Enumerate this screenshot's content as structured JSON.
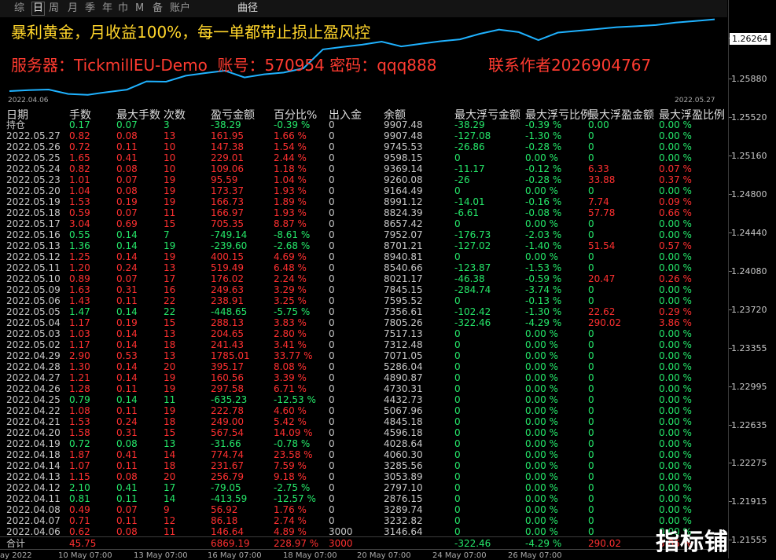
{
  "colors": {
    "profit": "#ff3030",
    "loss": "#25e86a",
    "neutral": "#c8c8c8",
    "equity_line": "#1fb2ff",
    "accent_yellow": "#ffd52b"
  },
  "periods": [
    "综",
    "日",
    "周",
    "月",
    "季",
    "年",
    "巾",
    "M",
    "备",
    "账户"
  ],
  "periods_active": 1,
  "equity_tab": "曲径",
  "banner": {
    "line1": "暴利黄金，月收益100%，每一单都带止损止盈风控",
    "server": "服务器：TickmillEU-Demo  账号：570954 密码：qqq888",
    "contact": "联系作者2026904767"
  },
  "chart_dates": {
    "start": "2022.04.06",
    "end": "2022.05.27"
  },
  "equity_curve": [
    3146.64,
    3232.82,
    3289.74,
    2876.15,
    2797.1,
    3053.89,
    3285.56,
    4060.3,
    4028.64,
    4596.18,
    4845.18,
    5067.96,
    4432.73,
    4730.31,
    4890.87,
    5286.04,
    7071.05,
    7312.48,
    7517.13,
    7805.26,
    7356.61,
    7595.52,
    7845.15,
    8021.17,
    8540.66,
    8940.81,
    8701.21,
    7952.07,
    8657.42,
    8824.39,
    8991.12,
    9164.49,
    9260.08,
    9369.14,
    9598.15,
    9745.53,
    9907.48
  ],
  "price_axis": [
    "1.26264",
    "1.25880",
    "1.25520",
    "1.25160",
    "1.24800",
    "1.24440",
    "1.24080",
    "1.23720",
    "1.23355",
    "1.22995",
    "1.22635",
    "1.22275",
    "1.21915",
    "1.21555"
  ],
  "headers": [
    "日期",
    "手数",
    "最大手数",
    "次数",
    "盈亏金额",
    "百分比%",
    "出入金",
    "余额",
    "最大浮亏金额",
    "最大浮亏比例",
    "最大浮盈金额",
    "最大浮盈比例"
  ],
  "rows": [
    [
      "持仓",
      "0.17",
      "0.07",
      "3",
      "-38.29",
      "-0.39 %",
      "0",
      "9907.48",
      "-38.29",
      "-0.39 %",
      "0.00",
      "0.00 %"
    ],
    [
      "2022.05.27",
      "0.82",
      "0.08",
      "13",
      "161.95",
      "1.66 %",
      "0",
      "9907.48",
      "-127.08",
      "-1.30 %",
      "0",
      "0.00 %"
    ],
    [
      "2022.05.26",
      "0.72",
      "0.11",
      "10",
      "147.38",
      "1.54 %",
      "0",
      "9745.53",
      "-26.86",
      "-0.28 %",
      "0",
      "0.00 %"
    ],
    [
      "2022.05.25",
      "1.65",
      "0.41",
      "10",
      "229.01",
      "2.44 %",
      "0",
      "9598.15",
      "0",
      "0.00 %",
      "0",
      "0.00 %"
    ],
    [
      "2022.05.24",
      "0.82",
      "0.08",
      "10",
      "109.06",
      "1.18 %",
      "0",
      "9369.14",
      "-11.17",
      "-0.12 %",
      "6.33",
      "0.07 %"
    ],
    [
      "2022.05.23",
      "1.01",
      "0.07",
      "19",
      "95.59",
      "1.04 %",
      "0",
      "9260.08",
      "-26",
      "-0.28 %",
      "33.88",
      "0.37 %"
    ],
    [
      "2022.05.20",
      "1.04",
      "0.08",
      "19",
      "173.37",
      "1.93 %",
      "0",
      "9164.49",
      "0",
      "0.00 %",
      "0",
      "0.00 %"
    ],
    [
      "2022.05.19",
      "1.53",
      "0.19",
      "19",
      "166.73",
      "1.89 %",
      "0",
      "8991.12",
      "-14.01",
      "-0.16 %",
      "7.74",
      "0.09 %"
    ],
    [
      "2022.05.18",
      "0.59",
      "0.07",
      "11",
      "166.97",
      "1.93 %",
      "0",
      "8824.39",
      "-6.61",
      "-0.08 %",
      "57.78",
      "0.66 %"
    ],
    [
      "2022.05.17",
      "3.04",
      "0.69",
      "15",
      "705.35",
      "8.87 %",
      "0",
      "8657.42",
      "0",
      "0.00 %",
      "0",
      "0.00 %"
    ],
    [
      "2022.05.16",
      "0.55",
      "0.14",
      "7",
      "-749.14",
      "-8.61 %",
      "0",
      "7952.07",
      "-176.73",
      "-2.03 %",
      "0",
      "0.00 %"
    ],
    [
      "2022.05.13",
      "1.36",
      "0.14",
      "19",
      "-239.60",
      "-2.68 %",
      "0",
      "8701.21",
      "-127.02",
      "-1.40 %",
      "51.54",
      "0.57 %"
    ],
    [
      "2022.05.12",
      "1.25",
      "0.14",
      "19",
      "400.15",
      "4.69 %",
      "0",
      "8940.81",
      "0",
      "0.00 %",
      "0",
      "0.00 %"
    ],
    [
      "2022.05.11",
      "1.20",
      "0.24",
      "13",
      "519.49",
      "6.48 %",
      "0",
      "8540.66",
      "-123.87",
      "-1.53 %",
      "0",
      "0.00 %"
    ],
    [
      "2022.05.10",
      "0.89",
      "0.07",
      "17",
      "176.02",
      "2.24 %",
      "0",
      "8021.17",
      "-46.38",
      "-0.59 %",
      "20.47",
      "0.26 %"
    ],
    [
      "2022.05.09",
      "1.63",
      "0.31",
      "16",
      "249.63",
      "3.29 %",
      "0",
      "7845.15",
      "-284.74",
      "-3.74 %",
      "0",
      "0.00 %"
    ],
    [
      "2022.05.06",
      "1.43",
      "0.11",
      "22",
      "238.91",
      "3.25 %",
      "0",
      "7595.52",
      "0",
      "-0.13 %",
      "0",
      "0.00 %"
    ],
    [
      "2022.05.05",
      "1.47",
      "0.14",
      "22",
      "-448.65",
      "-5.75 %",
      "0",
      "7356.61",
      "-102.42",
      "-1.30 %",
      "22.62",
      "0.29 %"
    ],
    [
      "2022.05.04",
      "1.17",
      "0.19",
      "15",
      "288.13",
      "3.83 %",
      "0",
      "7805.26",
      "-322.46",
      "-4.29 %",
      "290.02",
      "3.86 %"
    ],
    [
      "2022.05.03",
      "1.03",
      "0.14",
      "13",
      "204.65",
      "2.80 %",
      "0",
      "7517.13",
      "0",
      "0.00 %",
      "0",
      "0.00 %"
    ],
    [
      "2022.05.02",
      "1.17",
      "0.14",
      "18",
      "241.43",
      "3.41 %",
      "0",
      "7312.48",
      "0",
      "0.00 %",
      "0",
      "0.00 %"
    ],
    [
      "2022.04.29",
      "2.90",
      "0.53",
      "13",
      "1785.01",
      "33.77 %",
      "0",
      "7071.05",
      "0",
      "0.00 %",
      "0",
      "0.00 %"
    ],
    [
      "2022.04.28",
      "1.30",
      "0.14",
      "20",
      "395.17",
      "8.08 %",
      "0",
      "5286.04",
      "0",
      "0.00 %",
      "0",
      "0.00 %"
    ],
    [
      "2022.04.27",
      "1.21",
      "0.14",
      "19",
      "160.56",
      "3.39 %",
      "0",
      "4890.87",
      "0",
      "0.00 %",
      "0",
      "0.00 %"
    ],
    [
      "2022.04.26",
      "1.28",
      "0.11",
      "19",
      "297.58",
      "6.71 %",
      "0",
      "4730.31",
      "0",
      "0.00 %",
      "0",
      "0.00 %"
    ],
    [
      "2022.04.25",
      "0.79",
      "0.14",
      "11",
      "-635.23",
      "-12.53 %",
      "0",
      "4432.73",
      "0",
      "0.00 %",
      "0",
      "0.00 %"
    ],
    [
      "2022.04.22",
      "1.08",
      "0.11",
      "19",
      "222.78",
      "4.60 %",
      "0",
      "5067.96",
      "0",
      "0.00 %",
      "0",
      "0.00 %"
    ],
    [
      "2022.04.21",
      "1.53",
      "0.24",
      "18",
      "249.00",
      "5.42 %",
      "0",
      "4845.18",
      "0",
      "0.00 %",
      "0",
      "0.00 %"
    ],
    [
      "2022.04.20",
      "1.58",
      "0.31",
      "15",
      "567.54",
      "14.09 %",
      "0",
      "4596.18",
      "0",
      "0.00 %",
      "0",
      "0.00 %"
    ],
    [
      "2022.04.19",
      "0.72",
      "0.08",
      "13",
      "-31.66",
      "-0.78 %",
      "0",
      "4028.64",
      "0",
      "0.00 %",
      "0",
      "0.00 %"
    ],
    [
      "2022.04.18",
      "1.87",
      "0.41",
      "14",
      "774.74",
      "23.58 %",
      "0",
      "4060.30",
      "0",
      "0.00 %",
      "0",
      "0.00 %"
    ],
    [
      "2022.04.14",
      "1.07",
      "0.11",
      "18",
      "231.67",
      "7.59 %",
      "0",
      "3285.56",
      "0",
      "0.00 %",
      "0",
      "0.00 %"
    ],
    [
      "2022.04.13",
      "1.15",
      "0.08",
      "20",
      "256.79",
      "9.18 %",
      "0",
      "3053.89",
      "0",
      "0.00 %",
      "0",
      "0.00 %"
    ],
    [
      "2022.04.12",
      "2.10",
      "0.41",
      "17",
      "-79.05",
      "-2.75 %",
      "0",
      "2797.10",
      "0",
      "0.00 %",
      "0",
      "0.00 %"
    ],
    [
      "2022.04.11",
      "0.81",
      "0.11",
      "14",
      "-413.59",
      "-12.57 %",
      "0",
      "2876.15",
      "0",
      "0.00 %",
      "0",
      "0.00 %"
    ],
    [
      "2022.04.08",
      "0.49",
      "0.07",
      "9",
      "56.92",
      "1.76 %",
      "0",
      "3289.74",
      "0",
      "0.00 %",
      "0",
      "0.00 %"
    ],
    [
      "2022.04.07",
      "0.71",
      "0.11",
      "12",
      "86.18",
      "2.74 %",
      "0",
      "3232.82",
      "0",
      "0.00 %",
      "0",
      "0.00 %"
    ],
    [
      "2022.04.06",
      "0.62",
      "0.08",
      "11",
      "146.64",
      "4.89 %",
      "3000",
      "3146.64",
      "0",
      "0.00 %",
      "0",
      "0.00 %"
    ]
  ],
  "total": [
    "合计",
    "45.75",
    "",
    "",
    "6869.19",
    "228.97 %",
    "3000",
    "",
    "-322.46",
    "-4.29 %",
    "290.02",
    "3.86 %"
  ],
  "x_axis_labels": [
    "ay 2022",
    "10 May 07:00",
    "13 May 07:00",
    "16 May 07:00",
    "18 May 07:00",
    "20 May 07:00",
    "24 May 07:00",
    "26 May 07:00"
  ],
  "watermark": "指标铺"
}
